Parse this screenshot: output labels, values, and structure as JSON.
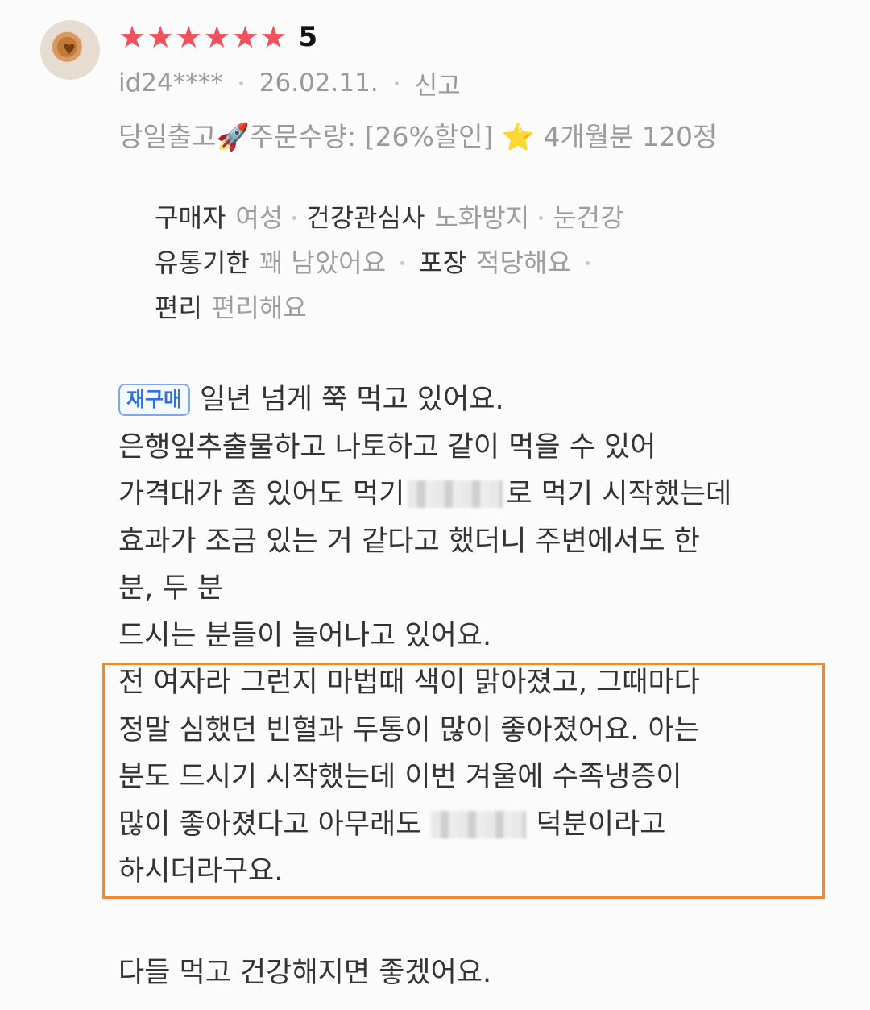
{
  "review": {
    "rating_stars": 6,
    "score": "5",
    "user_id": "id24****",
    "date": "26.02.11.",
    "report_label": "신고",
    "option_text": "당일출고🚀주문수량: [26%할인] ⭐ 4개월분 120정",
    "summary": {
      "buyer_key": "구매자",
      "buyer_val": "여성",
      "interest_key": "건강관심사",
      "interest_val1": "노화방지",
      "interest_val2": "눈건강",
      "expiry_key": "유통기한",
      "expiry_val": "꽤 남았어요",
      "package_key": "포장",
      "package_val": "적당해요",
      "convenience_key": "편리",
      "convenience_val": "편리해요"
    },
    "badge": "재구매",
    "body": {
      "l1": "일년 넘게 쭉 먹고 있어요.",
      "l2": "은행잎추출물하고 나토하고 같이 먹을 수 있어",
      "l3a": "가격대가 좀 있어도 먹기",
      "l3b": "로 먹기 시작했는데",
      "l4": "효과가 조금 있는 거 같다고 했더니 주변에서도 한",
      "l5": "분, 두 분",
      "l6": "드시는 분들이 늘어나고 있어요.",
      "l7": "전 여자라 그런지 마법때 색이 맑아졌고, 그때마다",
      "l8": "정말 심했던 빈혈과 두통이 많이 좋아졌어요. 아는",
      "l9": "분도 드시기 시작했는데 이번 겨울에 수족냉증이",
      "l10a": "많이 좋아졌다고 아무래도",
      "l10b": "덕분이라고",
      "l11": "하시더라구요.",
      "closing": "다들 먹고 건강해지면 좋겠어요."
    }
  },
  "colors": {
    "star": "#f0525b",
    "highlight_border": "#f08a2c",
    "badge_blue": "#2f6fe3"
  }
}
